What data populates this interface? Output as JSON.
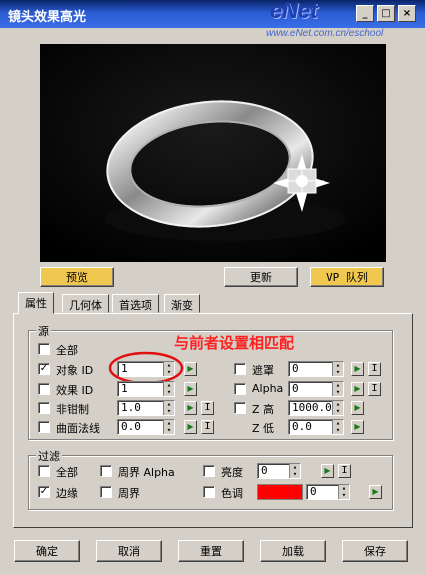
{
  "window": {
    "title": "镜头效果高光"
  },
  "watermark": {
    "brand": "eNet",
    "url": "www.eNet.com.cn/eschool"
  },
  "buttons": {
    "preview": "预览",
    "update": "更新",
    "vp_queue": "VP 队列"
  },
  "tabs": [
    "属性",
    "几何体",
    "首选项",
    "渐变"
  ],
  "source_group": {
    "label": "源",
    "all": "全部",
    "object_id": {
      "label": "对象 ID",
      "value": "1",
      "checked": true
    },
    "effect_id": {
      "label": "效果 ID",
      "value": "1",
      "checked": false
    },
    "unclamped": {
      "label": "非钳制",
      "value": "1.0",
      "checked": false
    },
    "surface_normal": {
      "label": "曲面法线",
      "value": "0.0",
      "checked": false
    },
    "mask": {
      "label": "遮罩",
      "value": "0",
      "checked": false
    },
    "alpha": {
      "label": "Alpha",
      "value": "0",
      "checked": false
    },
    "z_high": {
      "label": "Z 高",
      "value": "1000.0",
      "checked": false
    },
    "z_low": {
      "label": "Z 低",
      "value": "0.0"
    }
  },
  "filter_group": {
    "label": "过滤",
    "all": "全部",
    "perimeter_alpha": "周界 Alpha",
    "brightness": {
      "label": "亮度",
      "value": "0"
    },
    "edge": {
      "label": "边缘",
      "checked": true
    },
    "perimeter": "周界",
    "hue": {
      "label": "色调",
      "value": "0",
      "swatch": "#ff0000"
    }
  },
  "annotation": "与前者设置相匹配",
  "bottom_buttons": {
    "ok": "确定",
    "cancel": "取消",
    "reset": "重置",
    "load": "加载",
    "save": "保存"
  },
  "icons": {
    "map": "green-arrow-icon",
    "instance": "I"
  }
}
